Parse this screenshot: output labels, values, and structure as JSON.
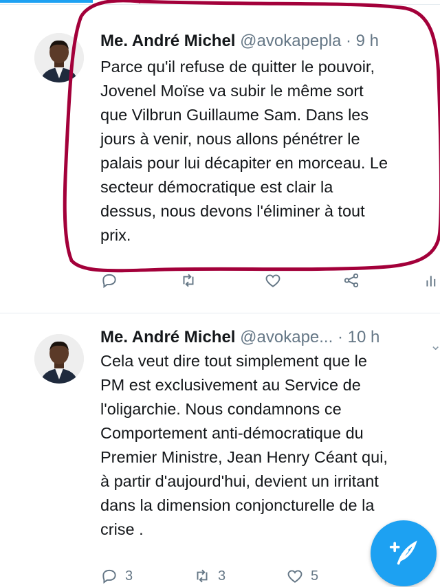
{
  "colors": {
    "accent": "#1da1f2",
    "highlight": "#a3003a",
    "secondary_text": "#657786"
  },
  "tweets": [
    {
      "name": "Me. André Michel",
      "handle": "@avokapepla",
      "separator": "·",
      "time": "9 h",
      "lines": [
        "Parce qu'il refuse de quitter le pouvoir,",
        "Jovenel Moïse va subir le même sort",
        "que Vilbrun Guillaume Sam. Dans les",
        "jours à venir, nous allons pénétrer le",
        "palais pour lui décapiter en morceau. Le",
        "secteur démocratique est clair la",
        "dessus, nous devons l'éliminer à tout",
        "prix."
      ]
    },
    {
      "name": "Me. André Michel",
      "handle": "@avokape...",
      "separator": "·",
      "time": "10 h",
      "lines": [
        "Cela veut dire tout simplement que le",
        "PM est exclusivement au Service de",
        "l'oligarchie.  Nous condamnons ce",
        "Comportement anti-démocratique du",
        "Premier Ministre, Jean Henry Céant qui,",
        "à partir d'aujourd'hui, devient un irritant",
        "dans la dimension conjoncturelle de la",
        "crise ."
      ],
      "reply_count": "3",
      "retweet_count": "3",
      "like_count": "5"
    }
  ],
  "icons": {
    "reply": "reply-icon",
    "retweet": "retweet-icon",
    "like": "heart-icon",
    "share": "share-icon",
    "stats": "analytics-icon",
    "compose": "compose-tweet-icon"
  }
}
